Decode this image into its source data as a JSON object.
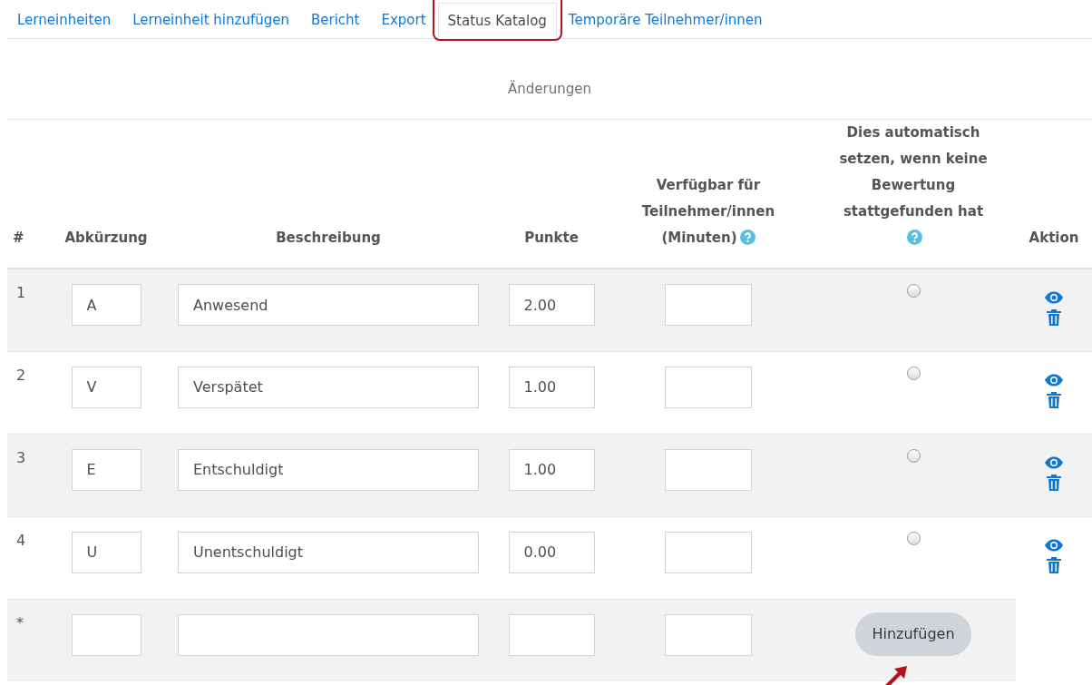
{
  "tabs": [
    {
      "label": "Lerneinheiten",
      "selected": false
    },
    {
      "label": "Lerneinheit hinzufügen",
      "selected": false
    },
    {
      "label": "Bericht",
      "selected": false
    },
    {
      "label": "Export",
      "selected": false
    },
    {
      "label": "Status Katalog",
      "selected": true
    },
    {
      "label": "Temporäre Teilnehmer/innen",
      "selected": false
    }
  ],
  "caption": "Änderungen",
  "table": {
    "columns": [
      {
        "label": "#",
        "help": false
      },
      {
        "label": "Abkürzung",
        "help": false
      },
      {
        "label": "Beschreibung",
        "help": false
      },
      {
        "label": "Punkte",
        "help": false
      },
      {
        "label": "Verfügbar für Teilnehmer/innen (Minuten)",
        "help": true
      },
      {
        "label": "Dies automatisch setzen, wenn keine Bewertung stattgefunden hat",
        "help": true
      },
      {
        "label": "Aktion",
        "help": false
      }
    ],
    "rows": [
      {
        "number": "1",
        "acronym": "A",
        "description": "Anwesend",
        "grade": "2.00",
        "auto_selected": false
      },
      {
        "number": "2",
        "acronym": "V",
        "description": "Verspätet",
        "grade": "1.00",
        "auto_selected": false
      },
      {
        "number": "3",
        "acronym": "E",
        "description": "Entschuldigt",
        "grade": "1.00",
        "auto_selected": false
      },
      {
        "number": "4",
        "acronym": "U",
        "description": "Unentschuldigt",
        "grade": "0.00",
        "auto_selected": false
      }
    ],
    "new_row": {
      "number": "*",
      "button": "Hinzufügen"
    }
  },
  "annotations": {
    "highlight_selected_tab": true,
    "arrow_to_button": true
  }
}
